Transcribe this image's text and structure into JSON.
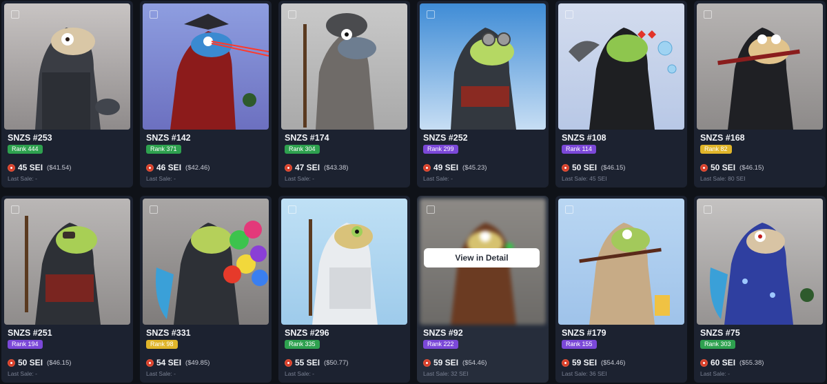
{
  "cards": [
    {
      "title": "SNZS #253",
      "rank": "Rank 444",
      "rank_color": "#2ea14f",
      "price": "45 SEI",
      "usd": "($41.54)",
      "last_sale": "Last Sale: -",
      "bg": [
        "#c8c4c3",
        "#8f8b8b"
      ]
    },
    {
      "title": "SNZS #142",
      "rank": "Rank 371",
      "rank_color": "#2ea14f",
      "price": "46 SEI",
      "usd": "($42.46)",
      "last_sale": "Last Sale: -",
      "bg": [
        "#8e9ee0",
        "#6c70c0"
      ]
    },
    {
      "title": "SNZS #174",
      "rank": "Rank 304",
      "rank_color": "#2ea14f",
      "price": "47 SEI",
      "usd": "($43.38)",
      "last_sale": "Last Sale: -",
      "bg": [
        "#c9c9c9",
        "#a9a9a9"
      ]
    },
    {
      "title": "SNZS #252",
      "rank": "Rank 299",
      "rank_color": "#7b48d8",
      "price": "49 SEI",
      "usd": "($45.23)",
      "last_sale": "Last Sale: -",
      "bg": [
        "#3f8cd6",
        "#c7def4"
      ]
    },
    {
      "title": "SNZS #108",
      "rank": "Rank 114",
      "rank_color": "#7b48d8",
      "price": "50 SEI",
      "usd": "($46.15)",
      "last_sale": "Last Sale: 45 SEI",
      "bg": [
        "#d3dcee",
        "#b8c8e6"
      ]
    },
    {
      "title": "SNZS #168",
      "rank": "Rank 82",
      "rank_color": "#e0b52a",
      "price": "50 SEI",
      "usd": "($46.15)",
      "last_sale": "Last Sale: 80 SEI",
      "bg": [
        "#b7b4b3",
        "#8d8a89"
      ]
    },
    {
      "title": "SNZS #251",
      "rank": "Rank 194",
      "rank_color": "#7b48d8",
      "price": "50 SEI",
      "usd": "($46.15)",
      "last_sale": "Last Sale: -",
      "bg": [
        "#bab7b6",
        "#8f8c8b"
      ]
    },
    {
      "title": "SNZS #331",
      "rank": "Rank 98",
      "rank_color": "#e0b52a",
      "price": "54 SEI",
      "usd": "($49.85)",
      "last_sale": "Last Sale: -",
      "bg": [
        "#a9a6a5",
        "#7f7c7b"
      ]
    },
    {
      "title": "SNZS #296",
      "rank": "Rank 335",
      "rank_color": "#2ea14f",
      "price": "55 SEI",
      "usd": "($50.77)",
      "last_sale": "Last Sale: -",
      "bg": [
        "#bfe0f5",
        "#9ecbeb"
      ]
    },
    {
      "title": "SNZS #92",
      "rank": "Rank 222",
      "rank_color": "#7b48d8",
      "price": "59 SEI",
      "usd": "($54.46)",
      "last_sale": "Last Sale: 32 SEI",
      "bg": [
        "#8d8a86",
        "#6c6a67"
      ],
      "hover": true,
      "button": "View in Detail"
    },
    {
      "title": "SNZS #179",
      "rank": "Rank 155",
      "rank_color": "#7b48d8",
      "price": "59 SEI",
      "usd": "($54.46)",
      "last_sale": "Last Sale: 36 SEI",
      "bg": [
        "#b9d6f2",
        "#9fc3ea"
      ]
    },
    {
      "title": "SNZS #75",
      "rank": "Rank 303",
      "rank_color": "#2ea14f",
      "price": "60 SEI",
      "usd": "($55.38)",
      "last_sale": "Last Sale: -",
      "bg": [
        "#c4c2c1",
        "#969392"
      ]
    }
  ]
}
